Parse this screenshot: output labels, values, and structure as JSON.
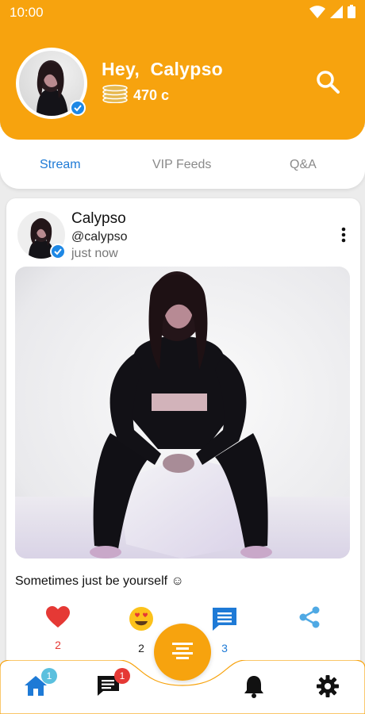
{
  "status_bar": {
    "time": "10:00"
  },
  "header": {
    "greeting": "Hey,  Calypso",
    "coins": "470 c",
    "accent_color": "#f7a30e"
  },
  "tabs": [
    {
      "label": "Stream",
      "active": true
    },
    {
      "label": "VIP Feeds",
      "active": false
    },
    {
      "label": "Q&A",
      "active": false
    }
  ],
  "post": {
    "author_name": "Calypso",
    "author_handle": "@calypso",
    "posted": "just now",
    "caption": "Sometimes just be yourself ☺",
    "reactions": [
      {
        "icon": "heart-icon",
        "count": "2",
        "color": "#e53935"
      },
      {
        "icon": "heart-eyes-emoji-icon",
        "count": "2",
        "color": "#222222"
      },
      {
        "icon": "comment-icon",
        "count": "3",
        "color": "#1e7ad6"
      },
      {
        "icon": "share-icon",
        "count": "",
        "color": "#4fa9e4"
      }
    ]
  },
  "bottom_nav": {
    "home_badge": "1",
    "messages_badge": "1"
  }
}
